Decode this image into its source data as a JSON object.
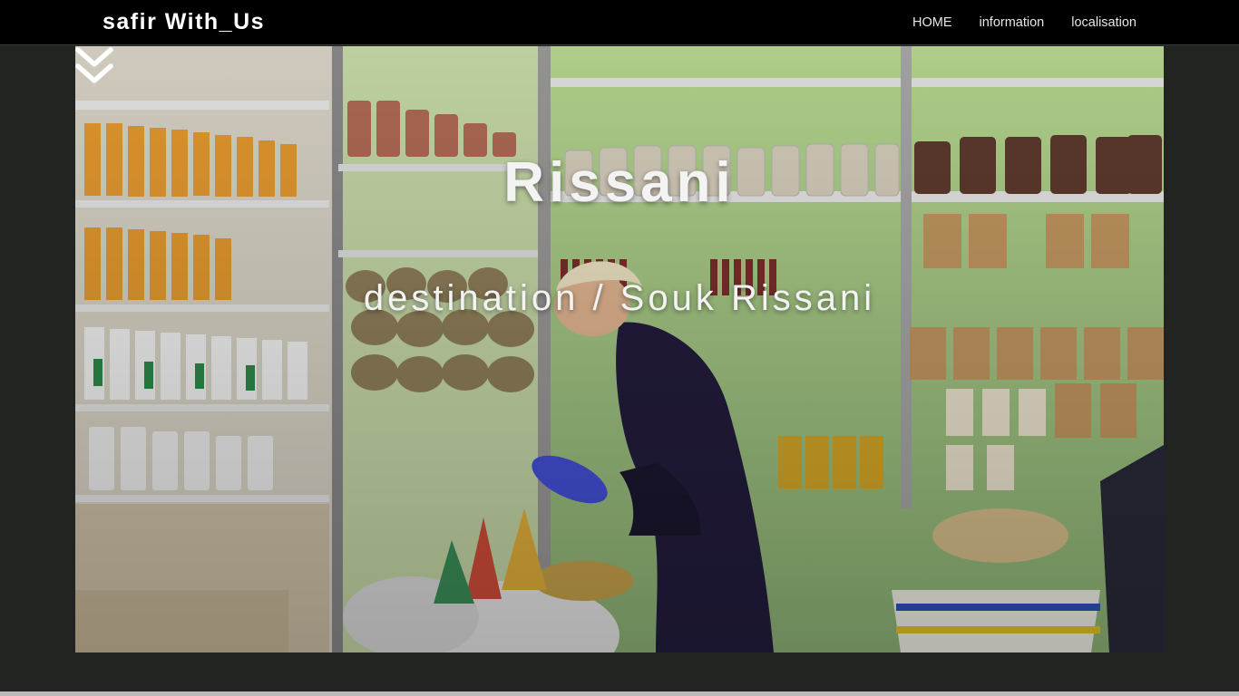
{
  "navbar": {
    "brand": "safir With_Us",
    "links": [
      "HOME",
      "information",
      "localisation"
    ]
  },
  "hero": {
    "title": "Rissani",
    "subtitle": "destination / Souk Rissani",
    "scroll_icon": "double-chevron-down-icon"
  },
  "colors": {
    "navbar_bg": "#000000",
    "page_bg": "#222422",
    "text": "#ffffff"
  }
}
